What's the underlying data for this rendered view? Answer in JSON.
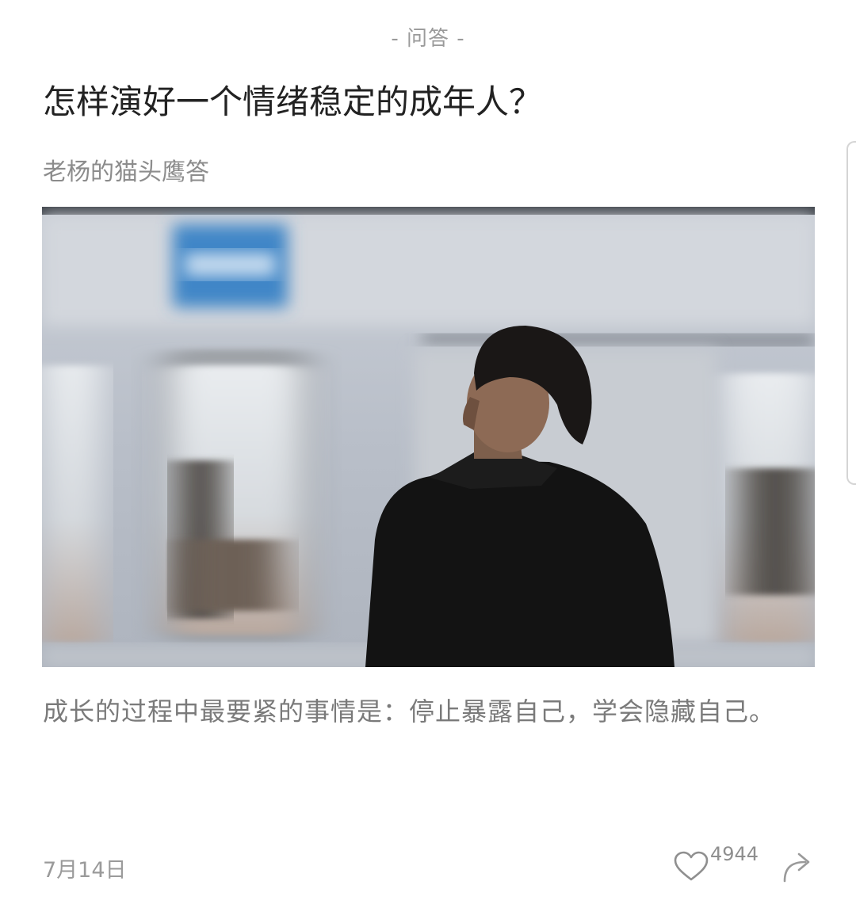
{
  "article": {
    "category": "- 问答 -",
    "title": "怎样演好一个情绪稳定的成年人？",
    "author": "老杨的猫头鹰答",
    "excerpt": "成长的过程中最要紧的事情是：停止暴露自己，学会隐藏自己。",
    "date": "7月14日"
  },
  "actions": {
    "like_count": "4944",
    "like_icon": "heart-outline-icon",
    "share_icon": "share-arrow-icon"
  },
  "image": {
    "icon": "cover-photo-man-subway-motion-blur"
  },
  "colors": {
    "title": "#222222",
    "muted": "#9a9a9a",
    "excerpt": "#7a7a7a"
  }
}
